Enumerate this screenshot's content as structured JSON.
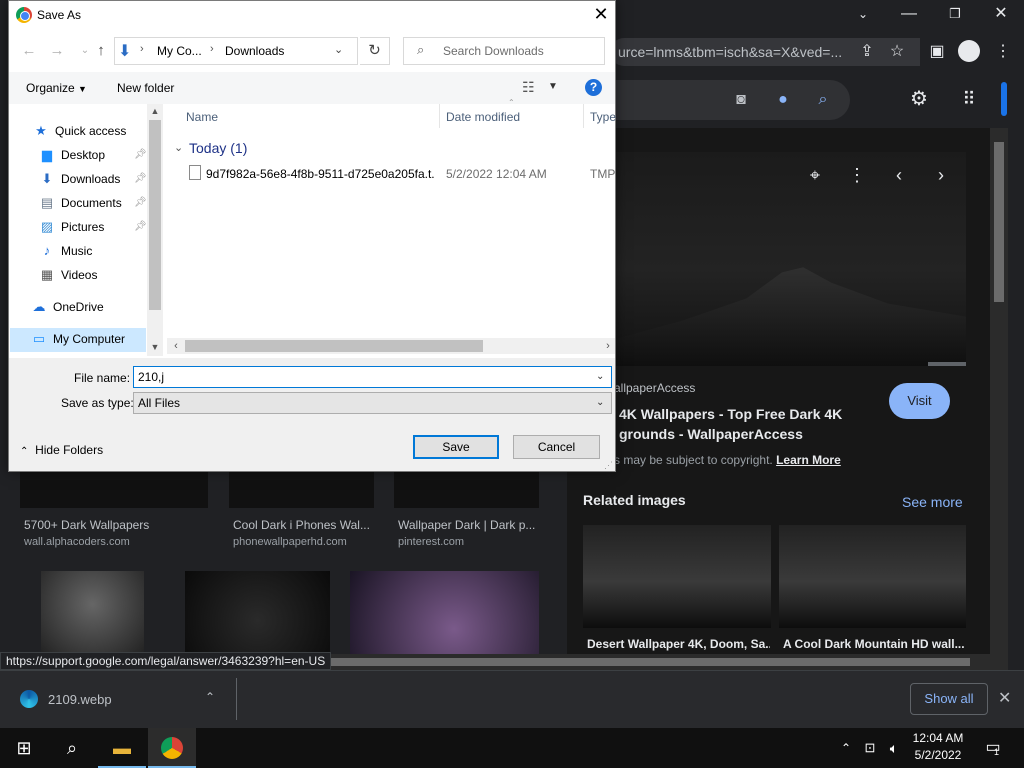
{
  "browser": {
    "address": "urce=lnms&tbm=isch&sa=X&ved=...",
    "status_url": "https://support.google.com/legal/answer/3463239?hl=en-US"
  },
  "image_results": [
    {
      "title": "5700+ Dark Wallpapers",
      "source": "wall.alphacoders.com"
    },
    {
      "title": "Cool Dark i Phones Wal...",
      "source": "phonewallpaperhd.com"
    },
    {
      "title": "Wallpaper Dark | Dark p...",
      "source": "pinterest.com"
    }
  ],
  "preview": {
    "site": "allpaperAccess",
    "title": "4K Wallpapers - Top Free Dark 4K grounds - WallpaperAccess",
    "visit_label": "Visit",
    "copyright_text": "s may be subject to copyright.",
    "learn_more": "Learn More",
    "related_title": "Related images",
    "see_more": "See more",
    "related": [
      {
        "caption": "Desert Wallpaper 4K, Doom, Sa..."
      },
      {
        "caption": "A Cool Dark Mountain HD wall..."
      }
    ]
  },
  "download_shelf": {
    "file": "2109.webp",
    "show_all": "Show all"
  },
  "taskbar": {
    "time": "12:04 AM",
    "date": "5/2/2022",
    "notification_count": "1"
  },
  "dialog": {
    "title": "Save As",
    "breadcrumb": [
      "My Co...",
      "Downloads"
    ],
    "search_placeholder": "Search Downloads",
    "organize_label": "Organize",
    "new_folder_label": "New folder",
    "nav_items": [
      {
        "label": "Quick access",
        "icon": "star-icon"
      },
      {
        "label": "Desktop",
        "icon": "desktop-icon",
        "pinned": true
      },
      {
        "label": "Downloads",
        "icon": "download-icon",
        "pinned": true
      },
      {
        "label": "Documents",
        "icon": "documents-icon",
        "pinned": true
      },
      {
        "label": "Pictures",
        "icon": "pictures-icon",
        "pinned": true
      },
      {
        "label": "Music",
        "icon": "music-icon"
      },
      {
        "label": "Videos",
        "icon": "videos-icon"
      },
      {
        "label": "OneDrive",
        "icon": "cloud-icon"
      },
      {
        "label": "My Computer",
        "icon": "computer-icon",
        "selected": true
      }
    ],
    "columns": [
      "Name",
      "Date modified",
      "Type"
    ],
    "group_label": "Today (1)",
    "files": [
      {
        "name": "9d7f982a-56e8-4f8b-9511-d725e0a205fa.t...",
        "date": "5/2/2022 12:04 AM",
        "type": "TMP"
      }
    ],
    "file_name_label": "File name:",
    "file_name_value": "210,j",
    "save_type_label": "Save as type:",
    "save_type_value": "All Files",
    "hide_folders_label": "Hide Folders",
    "save_label": "Save",
    "cancel_label": "Cancel"
  },
  "colors": {
    "accent": "#0078d7",
    "selection": "#cce8ff",
    "link": "#8ab4f8"
  }
}
